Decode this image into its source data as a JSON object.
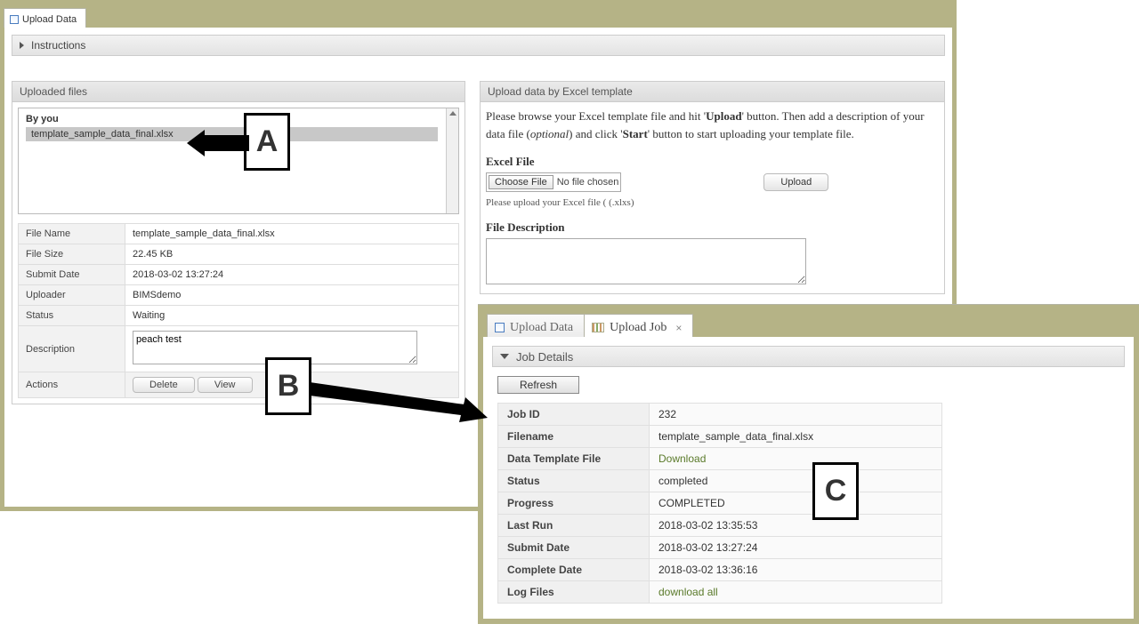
{
  "annotations": {
    "a": "A",
    "b": "B",
    "c": "C"
  },
  "window1": {
    "tab": "Upload Data",
    "instructions": "Instructions",
    "uploaded_files_panel": "Uploaded files",
    "by_you": "By you",
    "selected_file": "template_sample_data_final.xlsx",
    "meta": {
      "file_name_label": "File Name",
      "file_name": "template_sample_data_final.xlsx",
      "file_size_label": "File Size",
      "file_size": "22.45 KB",
      "submit_date_label": "Submit Date",
      "submit_date": "2018-03-02 13:27:24",
      "uploader_label": "Uploader",
      "uploader": "BIMSdemo",
      "status_label": "Status",
      "status": "Waiting",
      "description_label": "Description",
      "description": "peach test",
      "actions_label": "Actions",
      "delete_btn": "Delete",
      "view_btn": "View"
    },
    "upload_panel": "Upload data by Excel template",
    "upload_text_1a": "Please browse your Excel template file and hit '",
    "upload_text_1b": "Upload",
    "upload_text_1c": "' button. Then add a description of your data file (",
    "upload_text_1d": "optional",
    "upload_text_1e": ") and click '",
    "upload_text_1f": "Start",
    "upload_text_1g": "' button to start uploading your template file.",
    "excel_file_label": "Excel File",
    "choose_file_btn": "Choose File",
    "no_file_chosen": "No file chosen",
    "upload_btn": "Upload",
    "upload_help": "Please upload your Excel file ( (.xlxs)",
    "file_desc_label": "File Description"
  },
  "window2": {
    "tab_upload_data": "Upload Data",
    "tab_upload_job": "Upload Job",
    "job_details": "Job Details",
    "refresh_btn": "Refresh",
    "rows": {
      "job_id_l": "Job ID",
      "job_id_v": "232",
      "filename_l": "Filename",
      "filename_v": "template_sample_data_final.xlsx",
      "dtf_l": "Data Template File",
      "dtf_v": "Download",
      "status_l": "Status",
      "status_v": "completed",
      "progress_l": "Progress",
      "progress_v": "COMPLETED",
      "last_run_l": "Last Run",
      "last_run_v": "2018-03-02 13:35:53",
      "submit_l": "Submit Date",
      "submit_v": "2018-03-02 13:27:24",
      "complete_l": "Complete Date",
      "complete_v": "2018-03-02 13:36:16",
      "log_l": "Log Files",
      "log_v": "download all"
    }
  }
}
